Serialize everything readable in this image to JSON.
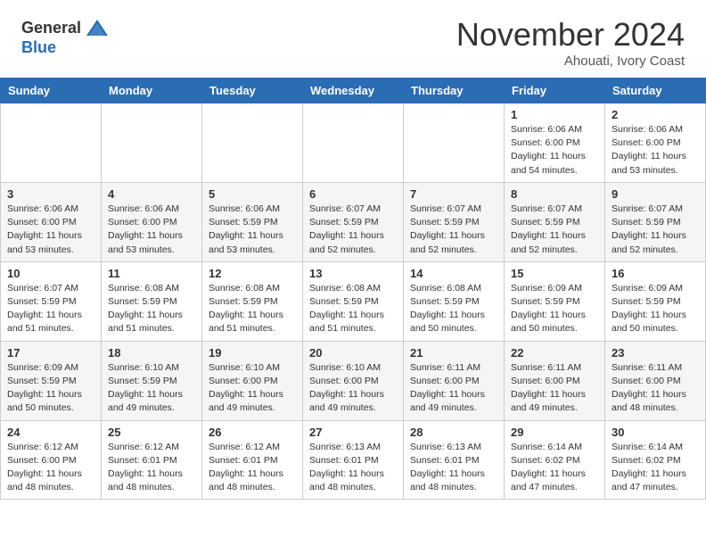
{
  "header": {
    "logo_general": "General",
    "logo_blue": "Blue",
    "month": "November 2024",
    "location": "Ahouati, Ivory Coast"
  },
  "days_of_week": [
    "Sunday",
    "Monday",
    "Tuesday",
    "Wednesday",
    "Thursday",
    "Friday",
    "Saturday"
  ],
  "weeks": [
    [
      {
        "day": "",
        "info": ""
      },
      {
        "day": "",
        "info": ""
      },
      {
        "day": "",
        "info": ""
      },
      {
        "day": "",
        "info": ""
      },
      {
        "day": "",
        "info": ""
      },
      {
        "day": "1",
        "info": "Sunrise: 6:06 AM\nSunset: 6:00 PM\nDaylight: 11 hours and 54 minutes."
      },
      {
        "day": "2",
        "info": "Sunrise: 6:06 AM\nSunset: 6:00 PM\nDaylight: 11 hours and 53 minutes."
      }
    ],
    [
      {
        "day": "3",
        "info": "Sunrise: 6:06 AM\nSunset: 6:00 PM\nDaylight: 11 hours and 53 minutes."
      },
      {
        "day": "4",
        "info": "Sunrise: 6:06 AM\nSunset: 6:00 PM\nDaylight: 11 hours and 53 minutes."
      },
      {
        "day": "5",
        "info": "Sunrise: 6:06 AM\nSunset: 5:59 PM\nDaylight: 11 hours and 53 minutes."
      },
      {
        "day": "6",
        "info": "Sunrise: 6:07 AM\nSunset: 5:59 PM\nDaylight: 11 hours and 52 minutes."
      },
      {
        "day": "7",
        "info": "Sunrise: 6:07 AM\nSunset: 5:59 PM\nDaylight: 11 hours and 52 minutes."
      },
      {
        "day": "8",
        "info": "Sunrise: 6:07 AM\nSunset: 5:59 PM\nDaylight: 11 hours and 52 minutes."
      },
      {
        "day": "9",
        "info": "Sunrise: 6:07 AM\nSunset: 5:59 PM\nDaylight: 11 hours and 52 minutes."
      }
    ],
    [
      {
        "day": "10",
        "info": "Sunrise: 6:07 AM\nSunset: 5:59 PM\nDaylight: 11 hours and 51 minutes."
      },
      {
        "day": "11",
        "info": "Sunrise: 6:08 AM\nSunset: 5:59 PM\nDaylight: 11 hours and 51 minutes."
      },
      {
        "day": "12",
        "info": "Sunrise: 6:08 AM\nSunset: 5:59 PM\nDaylight: 11 hours and 51 minutes."
      },
      {
        "day": "13",
        "info": "Sunrise: 6:08 AM\nSunset: 5:59 PM\nDaylight: 11 hours and 51 minutes."
      },
      {
        "day": "14",
        "info": "Sunrise: 6:08 AM\nSunset: 5:59 PM\nDaylight: 11 hours and 50 minutes."
      },
      {
        "day": "15",
        "info": "Sunrise: 6:09 AM\nSunset: 5:59 PM\nDaylight: 11 hours and 50 minutes."
      },
      {
        "day": "16",
        "info": "Sunrise: 6:09 AM\nSunset: 5:59 PM\nDaylight: 11 hours and 50 minutes."
      }
    ],
    [
      {
        "day": "17",
        "info": "Sunrise: 6:09 AM\nSunset: 5:59 PM\nDaylight: 11 hours and 50 minutes."
      },
      {
        "day": "18",
        "info": "Sunrise: 6:10 AM\nSunset: 5:59 PM\nDaylight: 11 hours and 49 minutes."
      },
      {
        "day": "19",
        "info": "Sunrise: 6:10 AM\nSunset: 6:00 PM\nDaylight: 11 hours and 49 minutes."
      },
      {
        "day": "20",
        "info": "Sunrise: 6:10 AM\nSunset: 6:00 PM\nDaylight: 11 hours and 49 minutes."
      },
      {
        "day": "21",
        "info": "Sunrise: 6:11 AM\nSunset: 6:00 PM\nDaylight: 11 hours and 49 minutes."
      },
      {
        "day": "22",
        "info": "Sunrise: 6:11 AM\nSunset: 6:00 PM\nDaylight: 11 hours and 49 minutes."
      },
      {
        "day": "23",
        "info": "Sunrise: 6:11 AM\nSunset: 6:00 PM\nDaylight: 11 hours and 48 minutes."
      }
    ],
    [
      {
        "day": "24",
        "info": "Sunrise: 6:12 AM\nSunset: 6:00 PM\nDaylight: 11 hours and 48 minutes."
      },
      {
        "day": "25",
        "info": "Sunrise: 6:12 AM\nSunset: 6:01 PM\nDaylight: 11 hours and 48 minutes."
      },
      {
        "day": "26",
        "info": "Sunrise: 6:12 AM\nSunset: 6:01 PM\nDaylight: 11 hours and 48 minutes."
      },
      {
        "day": "27",
        "info": "Sunrise: 6:13 AM\nSunset: 6:01 PM\nDaylight: 11 hours and 48 minutes."
      },
      {
        "day": "28",
        "info": "Sunrise: 6:13 AM\nSunset: 6:01 PM\nDaylight: 11 hours and 48 minutes."
      },
      {
        "day": "29",
        "info": "Sunrise: 6:14 AM\nSunset: 6:02 PM\nDaylight: 11 hours and 47 minutes."
      },
      {
        "day": "30",
        "info": "Sunrise: 6:14 AM\nSunset: 6:02 PM\nDaylight: 11 hours and 47 minutes."
      }
    ]
  ]
}
